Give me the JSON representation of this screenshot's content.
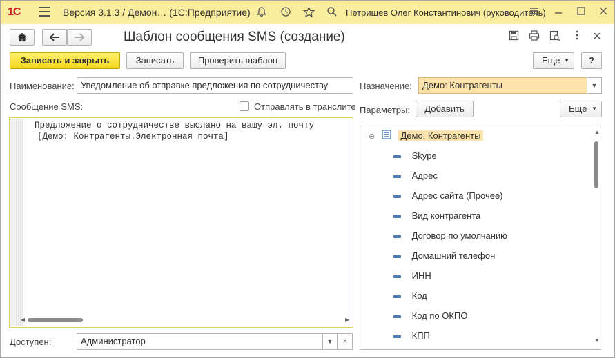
{
  "titlebar": {
    "logo": "1С",
    "title": "Версия 3.1.3 / Демон…   (1С:Предприятие)",
    "user": "Петрищев Олег Константинович (руководитель)"
  },
  "toolbar": {
    "form_title": "Шаблон сообщения SMS (создание)",
    "save_close_label": "Записать и закрыть",
    "save_label": "Записать",
    "check_label": "Проверить шаблон",
    "more_label": "Еще",
    "help_label": "?"
  },
  "fields": {
    "name_label": "Наименование:",
    "name_value": "Уведомление об отправке предложения по сотрудничеству",
    "purpose_label": "Назначение:",
    "purpose_value": "Демо: Контрагенты",
    "sms_label": "Сообщение SMS:",
    "translit_label": "Отправлять в транслите",
    "params_label": "Параметры:",
    "add_label": "Добавить",
    "params_more_label": "Еще",
    "available_label": "Доступен:",
    "available_value": "Администратор"
  },
  "editor": {
    "line1": "Предложение о сотрудничестве выслано на вашу эл. почту",
    "line2": "[Демо: Контрагенты.Электронная почта]"
  },
  "tree": {
    "root": "Демо: Контрагенты",
    "items": [
      "Skype",
      "Адрес",
      "Адрес сайта (Прочее)",
      "Вид контрагента",
      "Договор по умолчанию",
      "Домашний телефон",
      "ИНН",
      "Код",
      "Код по ОКПО",
      "КПП"
    ]
  }
}
